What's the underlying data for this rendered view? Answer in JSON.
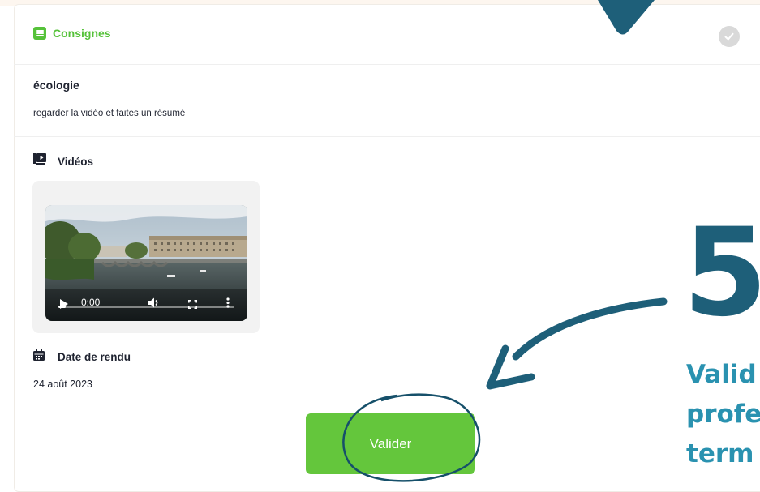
{
  "instructions_section": {
    "title": "Consignes",
    "icon": "list-icon",
    "status_icon": "check-icon"
  },
  "assignment": {
    "subject": "écologie",
    "instruction": "regarder la vidéo et faites un résumé"
  },
  "videos": {
    "label": "Vidéos",
    "icon": "video-library-icon",
    "player": {
      "time": "0:00",
      "progress": 0.0
    }
  },
  "due_date": {
    "label": "Date de rendu",
    "icon": "calendar-icon",
    "value": "24 août 2023"
  },
  "submit_button": {
    "label": "Valider",
    "color": "#64c63c"
  },
  "tutorial_overlay": {
    "step_number": "5",
    "callout_lines": [
      "Valid",
      "profe",
      "term"
    ],
    "accent_dark": "#1e5f79",
    "accent_light": "#2a92b0"
  },
  "colors": {
    "accent_green": "#56c23a",
    "text": "#1f2330"
  }
}
